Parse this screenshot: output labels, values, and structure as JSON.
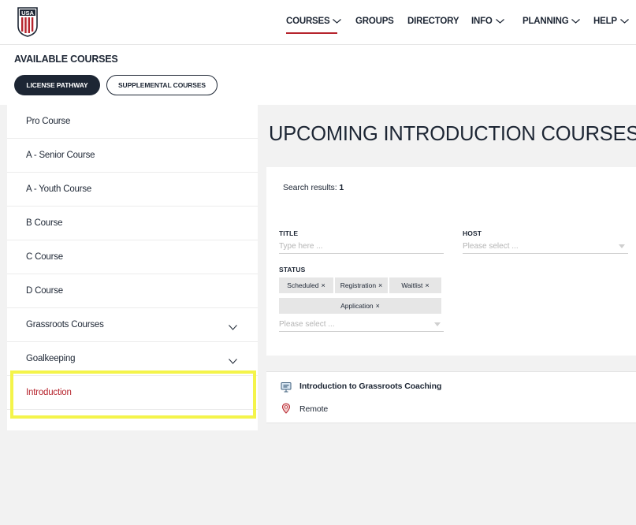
{
  "header": {
    "logo_icon": "usa-soccer-crest-icon",
    "nav": [
      {
        "label": "COURSES",
        "has_dropdown": true,
        "active": true
      },
      {
        "label": "GROUPS",
        "has_dropdown": false
      },
      {
        "label": "DIRECTORY",
        "has_dropdown": false
      },
      {
        "label": "INFO",
        "has_dropdown": true
      },
      {
        "label": "PLANNING",
        "has_dropdown": true
      },
      {
        "label": "HELP",
        "has_dropdown": true
      }
    ],
    "accent_color": "#b6242d"
  },
  "subheader": {
    "title": "AVAILABLE COURSES",
    "tabs": [
      {
        "label": "LICENSE PATHWAY",
        "selected": true
      },
      {
        "label": "SUPPLEMENTAL COURSES",
        "selected": false
      }
    ]
  },
  "sidebar": {
    "items": [
      {
        "label": "Pro Course"
      },
      {
        "label": "A - Senior Course"
      },
      {
        "label": "A - Youth Course"
      },
      {
        "label": "B Course"
      },
      {
        "label": "C Course"
      },
      {
        "label": "D Course"
      },
      {
        "label": "Grassroots Courses",
        "expandable": true
      },
      {
        "label": "Goalkeeping",
        "expandable": true
      },
      {
        "label": "Introduction",
        "active": true
      }
    ]
  },
  "main": {
    "title": "UPCOMING INTRODUCTION COURSES",
    "filters": {
      "results_label": "Search results:",
      "results_count": "1",
      "title_label": "TITLE",
      "title_placeholder": "Type here ...",
      "host_label": "HOST",
      "host_placeholder": "Please select ...",
      "status_label": "STATUS",
      "status_tags": [
        "Scheduled",
        "Registration",
        "Waitlist",
        "Application"
      ],
      "status_placeholder": "Please select ..."
    },
    "result": {
      "title": "Introduction to Grassroots Coaching",
      "location": "Remote",
      "course_icon": "presentation-screen-icon",
      "location_icon": "map-pin-icon"
    }
  }
}
